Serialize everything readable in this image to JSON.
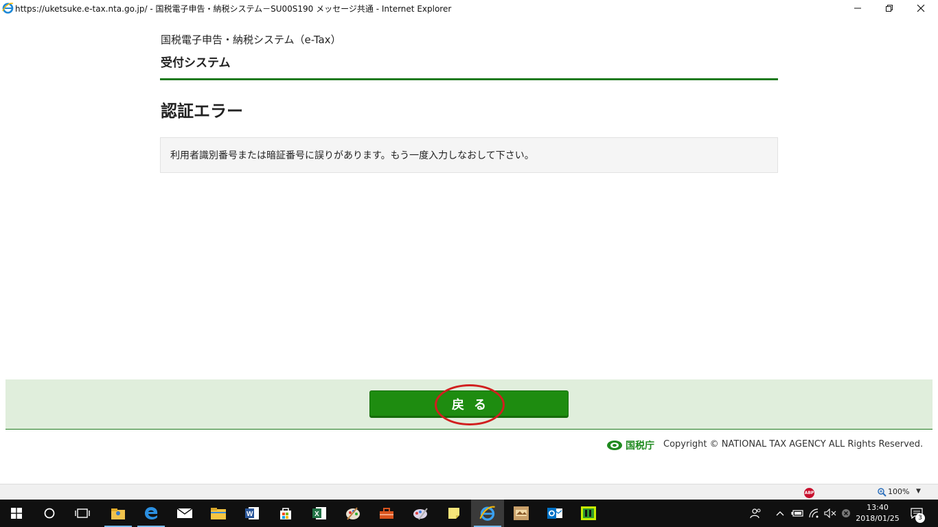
{
  "window": {
    "title": "https://uketsuke.e-tax.nta.go.jp/ - 国税電子申告・納税システム－SU00S190 メッセージ共通 - Internet Explorer",
    "controls": {
      "minimize": "minimize",
      "restore": "restore",
      "close": "close"
    }
  },
  "page": {
    "site_subtitle": "国税電子申告・納税システム（e-Tax）",
    "site_title": "受付システム",
    "heading": "認証エラー",
    "message": "利用者識別番号または暗証番号に誤りがあります。もう一度入力しなおして下さい。"
  },
  "footer": {
    "back_button_label": "戻る",
    "agency_logo_text": "国税庁",
    "copyright": "Copyright © NATIONAL TAX AGENCY ALL Rights Reserved."
  },
  "statusbar": {
    "adblock_badge": "ABP",
    "zoom_level": "100%"
  },
  "taskbar": {
    "time": "13:40",
    "date": "2018/01/25",
    "notification_count": "3"
  },
  "colors": {
    "accent_green": "#1e8c10",
    "rule_green": "#1f7a1f",
    "footer_bg": "#e0eedc",
    "annotation_red": "#d11f1f"
  }
}
